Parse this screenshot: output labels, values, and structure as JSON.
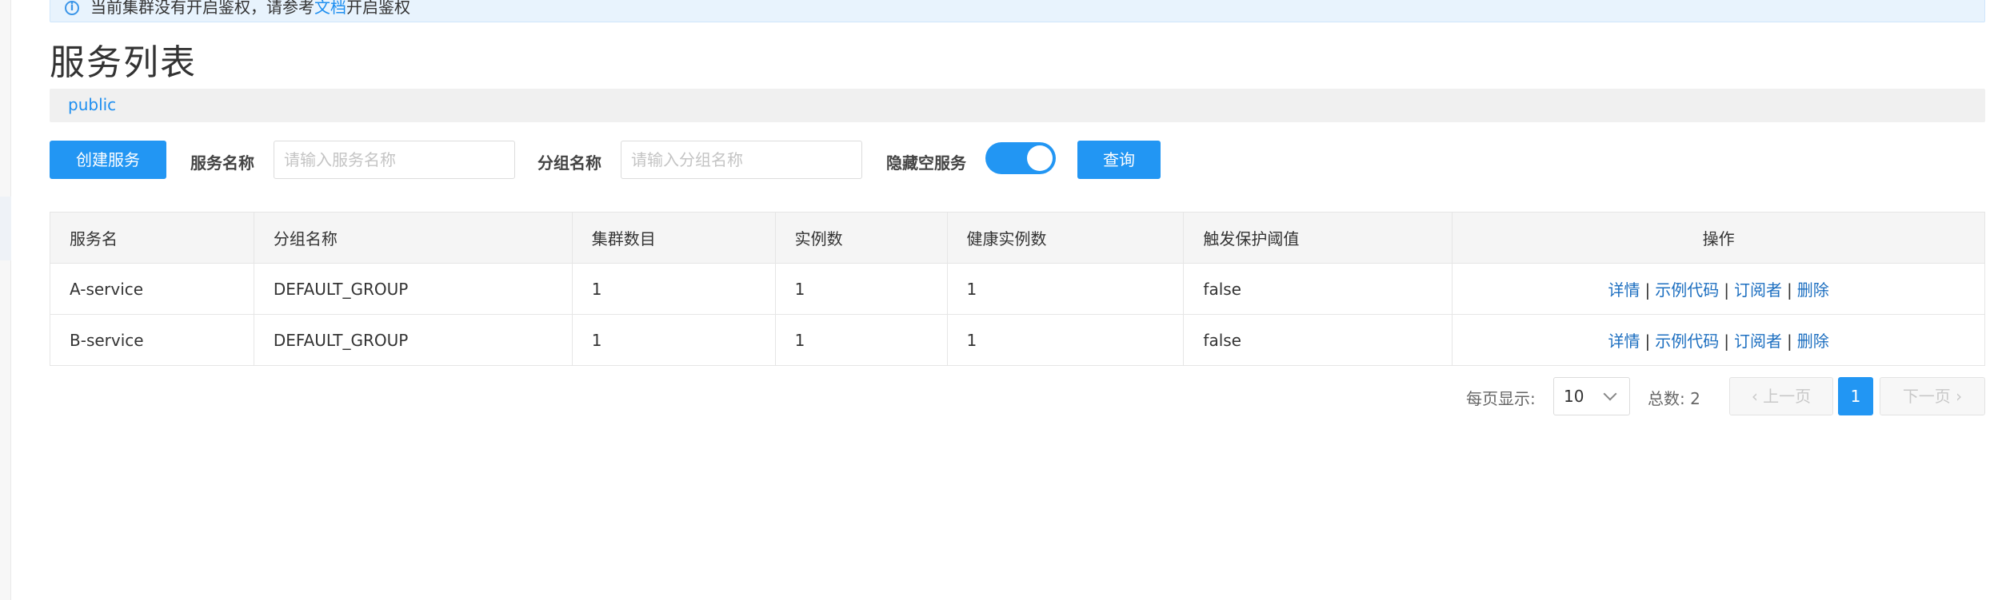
{
  "notice": {
    "text_before": "当前集群没有开启鉴权，请参考",
    "link": "文档",
    "text_after": "开启鉴权"
  },
  "page": {
    "title": "服务列表"
  },
  "namespace": {
    "current": "public"
  },
  "toolbar": {
    "create_label": "创建服务",
    "service_name_label": "服务名称",
    "service_name_placeholder": "请输入服务名称",
    "group_name_label": "分组名称",
    "group_name_placeholder": "请输入分组名称",
    "hide_empty_label": "隐藏空服务",
    "hide_empty_on": true,
    "query_label": "查询"
  },
  "table": {
    "columns": [
      "服务名",
      "分组名称",
      "集群数目",
      "实例数",
      "健康实例数",
      "触发保护阈值",
      "操作"
    ],
    "rows": [
      {
        "name": "A-service",
        "group": "DEFAULT_GROUP",
        "clusters": "1",
        "instances": "1",
        "healthy": "1",
        "protect": "false"
      },
      {
        "name": "B-service",
        "group": "DEFAULT_GROUP",
        "clusters": "1",
        "instances": "1",
        "healthy": "1",
        "protect": "false"
      }
    ],
    "actions": {
      "detail": "详情",
      "sample": "示例代码",
      "subscribers": "订阅者",
      "delete": "删除",
      "sep": "|"
    }
  },
  "pager": {
    "per_page_label": "每页显示:",
    "per_page_value": "10",
    "total_label": "总数: 2",
    "prev_label": "上一页",
    "next_label": "下一页",
    "current_page": "1"
  },
  "colors": {
    "primary": "#2296f3",
    "link": "#1d6fc0",
    "notice_bg": "#e8f3fd"
  }
}
